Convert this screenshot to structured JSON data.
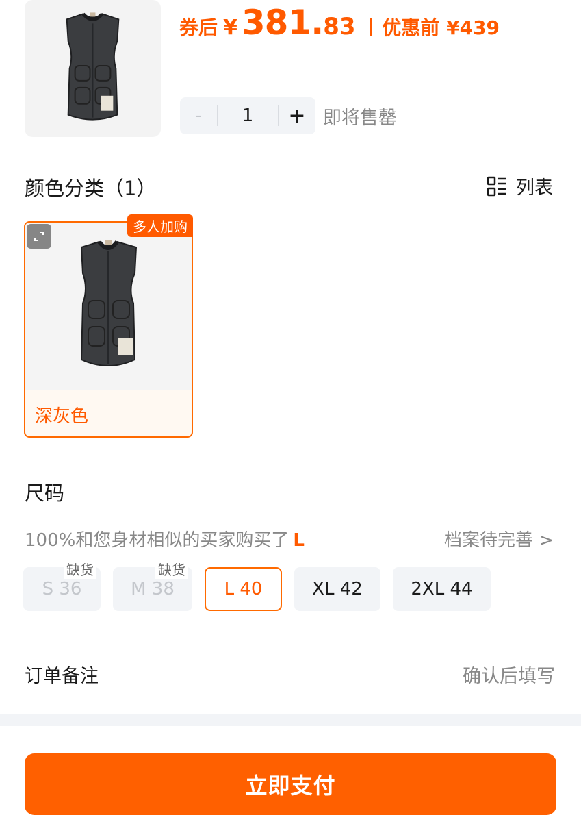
{
  "product": {
    "price_prefix": "券后",
    "currency": "¥",
    "price_int": "381.",
    "price_dec": "83",
    "separator": "|",
    "original_label": "优惠前 ¥439",
    "image_icon": "vest-product-image",
    "accent": "#ff5a00"
  },
  "quantity": {
    "minus": "-",
    "value": "1",
    "plus": "+",
    "stock_note": "即将售罄"
  },
  "color_section": {
    "title": "颜色分类（1）",
    "toggle_label": "列表",
    "toggle_icon": "list-view-icon",
    "options": [
      {
        "label": "深灰色",
        "badge": "多人加购",
        "selected": true
      }
    ]
  },
  "size_section": {
    "title": "尺码",
    "hint_text": "100%和您身材相似的买家购买了",
    "hint_highlight": "L",
    "profile_link": "档案待完善 >",
    "options": [
      {
        "label": "S 36",
        "status": "缺货",
        "disabled": true
      },
      {
        "label": "M 38",
        "status": "缺货",
        "disabled": true
      },
      {
        "label": "L 40",
        "selected": true
      },
      {
        "label": "XL 42"
      },
      {
        "label": "2XL 44"
      }
    ]
  },
  "remark": {
    "label": "订单备注",
    "hint": "确认后填写"
  },
  "pay_button": {
    "label": "立即支付",
    "color": "#ff6000"
  }
}
